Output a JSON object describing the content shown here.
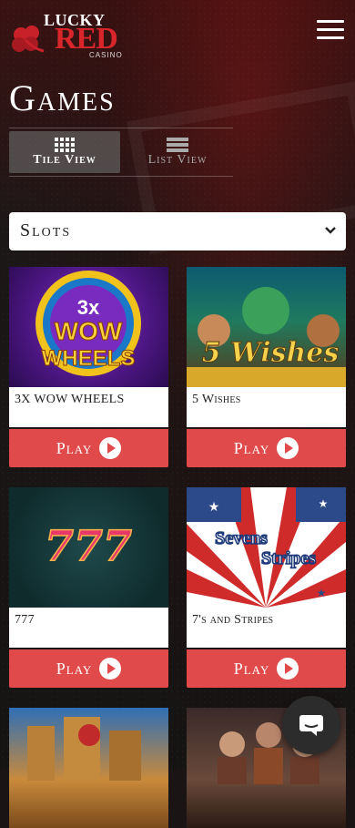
{
  "brand": {
    "top": "LUCKY",
    "main": "RED",
    "sub": "CASINO"
  },
  "page": {
    "title": "Games"
  },
  "view_toggle": {
    "tile_label": "Tile View",
    "list_label": "List View",
    "active": "tile"
  },
  "category_select": {
    "value": "Slots"
  },
  "games": [
    {
      "name": "3X WOW WHEELS",
      "thumb_text": "3x WOW WHEELS",
      "play_label": "Play"
    },
    {
      "name": "5 Wishes",
      "thumb_text": "5 Wishes",
      "play_label": "Play"
    },
    {
      "name": "777",
      "thumb_text": "777",
      "play_label": "Play"
    },
    {
      "name": "7's and Stripes",
      "thumb_text_1": "Sevens",
      "thumb_text_2": "Stripes",
      "play_label": "Play"
    }
  ],
  "colors": {
    "play_button": "#e14a4a",
    "brand_red": "#d9262b"
  }
}
